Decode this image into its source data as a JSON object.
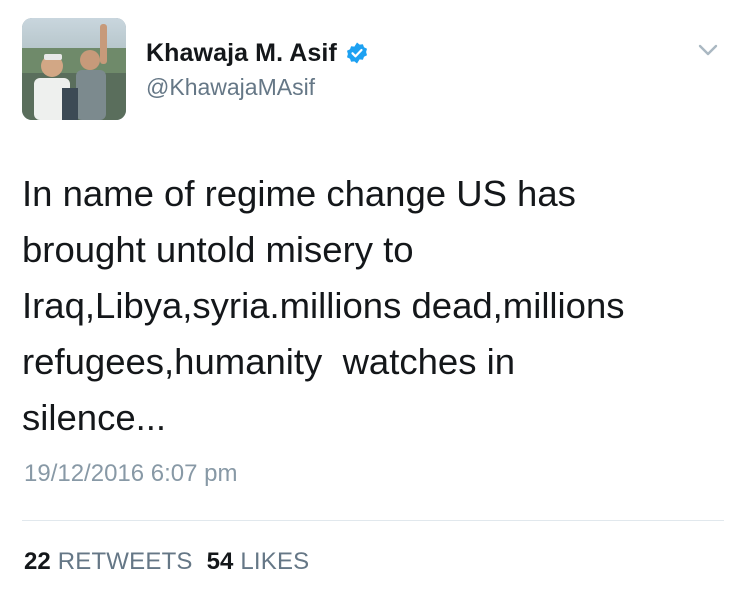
{
  "author": {
    "display_name": "Khawaja M. Asif",
    "handle": "@KhawajaMAsif",
    "verified": true
  },
  "tweet": {
    "text": "In name of regime change US has\nbrought untold misery to\nIraq,Libya,syria.millions dead,millions\nrefugees,humanity  watches in\nsilence...",
    "timestamp": "19/12/2016 6:07 pm"
  },
  "stats": {
    "retweets_count": "22",
    "retweets_label": "RETWEETS",
    "likes_count": "54",
    "likes_label": "LIKES"
  },
  "colors": {
    "verified_badge": "#1da1f2",
    "secondary_text": "#657786",
    "primary_text": "#14171a"
  },
  "icons": {
    "verified": "verified-badge-icon",
    "menu": "chevron-down-icon"
  }
}
